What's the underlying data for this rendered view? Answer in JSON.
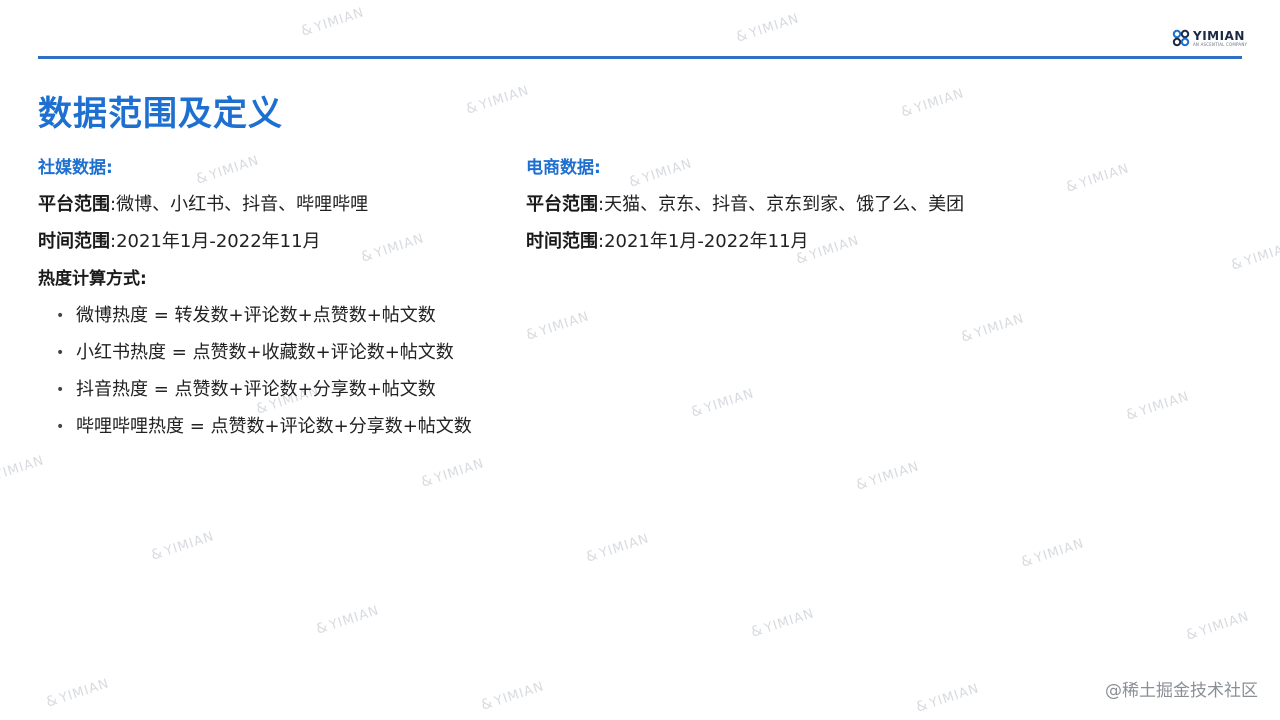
{
  "brand": {
    "name": "YIMIAN",
    "tagline": "AN ASCENTIAL COMPANY"
  },
  "page": {
    "title": "数据范围及定义"
  },
  "social": {
    "heading": "社媒数据:",
    "platform_label": "平台范围",
    "platform_value": "微博、小红书、抖音、哔哩哔哩",
    "time_label": "时间范围",
    "time_value": "2021年1月-2022年11月",
    "formula_heading": "热度计算方式:",
    "formulas": [
      "微博热度 = 转发数+评论数+点赞数+帖文数",
      "小红书热度 = 点赞数+收藏数+评论数+帖文数",
      "抖音热度 = 点赞数+评论数+分享数+帖文数",
      "哔哩哔哩热度 = 点赞数+评论数+分享数+帖文数"
    ]
  },
  "ecommerce": {
    "heading": "电商数据:",
    "platform_label": "平台范围",
    "platform_value": "天猫、京东、抖音、京东到家、饿了么、美团",
    "time_label": "时间范围",
    "time_value": "2021年1月-2022年11月"
  },
  "separator": ":",
  "bullet": "•",
  "watermark": {
    "mark": "&",
    "text": "YIMIAN"
  },
  "footer": {
    "credit": "@稀土掘金技术社区"
  },
  "colors": {
    "accent": "#1d6fd0",
    "rule": "#2f6fc8",
    "watermark": "#d7dbe0"
  }
}
